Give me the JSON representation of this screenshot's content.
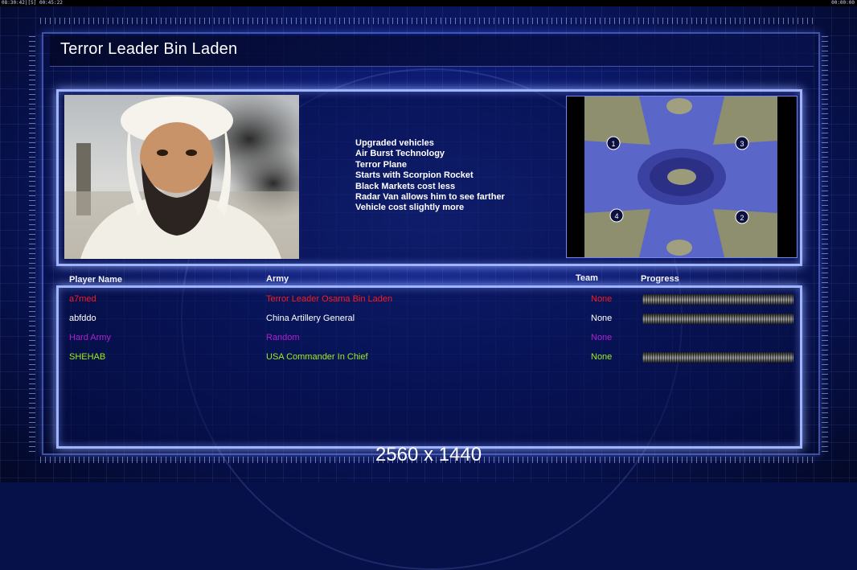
{
  "clock": {
    "left": "08:30:42|[S] 00:45:22",
    "right": "00:00:00"
  },
  "header": {
    "title": "Terror Leader Bin Laden"
  },
  "general": {
    "traits": [
      "Upgraded vehicles",
      "Air Burst Technology",
      "Terror Plane",
      "Starts with Scorpion Rocket",
      "Black Markets cost less",
      "Radar Van allows him to see farther",
      "Vehicle cost slightly more"
    ]
  },
  "map": {
    "positions": [
      "1",
      "2",
      "3",
      "4"
    ]
  },
  "players": {
    "headers": {
      "name": "Player Name",
      "army": "Army",
      "team": "Team",
      "progress": "Progress"
    },
    "rows": [
      {
        "name": "a7med",
        "army": "Terror Leader Osama Bin Laden",
        "team": "None",
        "color": "#ff1a1a",
        "has_progress": true
      },
      {
        "name": "abfddo",
        "army": "China Artillery General",
        "team": "None",
        "color": "#ffffff",
        "has_progress": true
      },
      {
        "name": "Hard Army",
        "army": "Random",
        "team": "None",
        "color": "#b21fd0",
        "has_progress": false
      },
      {
        "name": "SHEHAB",
        "army": "USA Commander In Chief",
        "team": "None",
        "color": "#9ef01a",
        "has_progress": true
      }
    ]
  },
  "overlay": {
    "resolution": "2560 x 1440"
  }
}
